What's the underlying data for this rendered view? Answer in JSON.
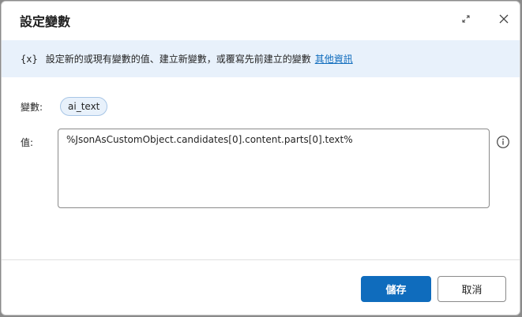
{
  "dialog": {
    "title": "設定變數",
    "expand_icon": "expand-icon",
    "close_icon": "close-icon"
  },
  "info": {
    "icon_text": "{x}",
    "text": "設定新的或現有變數的值、建立新變數，或覆寫先前建立的變數",
    "link": "其他資訊"
  },
  "form": {
    "variable_label": "變數:",
    "variable_name": "ai_text",
    "value_label": "值:",
    "value": "%JsonAsCustomObject.candidates[0].content.parts[0].text%",
    "help_icon": "info-icon"
  },
  "footer": {
    "save_label": "儲存",
    "cancel_label": "取消"
  },
  "colors": {
    "accent": "#0f6cbd",
    "info_bar": "#e8f1fb"
  }
}
